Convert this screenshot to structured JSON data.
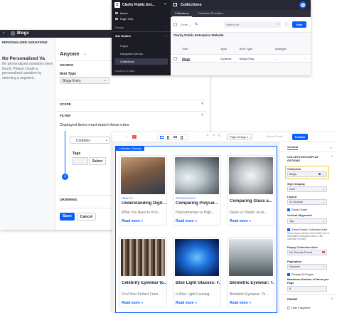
{
  "left_window": {
    "title": "Blogs",
    "panel_heading": "PERSONALIZED VARIATIONS",
    "no_var_title": "No Personalized Va",
    "no_var_desc": "No personalized variations were found. Please create a personalized variation by selecting a segment.",
    "segment": "Anyone",
    "source_label": "SOURCE",
    "item_type_label": "Item Type",
    "item_type_value": "Blogs Entry",
    "scope_label": "SCOPE",
    "filter_label": "FILTER",
    "filter_desc": "Displayed items must match these rules.",
    "contains_value": "Contains",
    "tags_label": "Tags",
    "select_label": "Select",
    "ordering_label": "ORDERING",
    "save_label": "Save",
    "cancel_label": "Cancel"
  },
  "top_window": {
    "app_title": "Clarity Public Ent...",
    "nav": [
      "Home",
      "Page Tree",
      "Design",
      "Site Builder",
      "Pages",
      "Navigation Menus",
      "Collections",
      "Content & Data"
    ],
    "header_title": "Collections",
    "tabs": [
      "Collections",
      "Collection Providers"
    ],
    "order_label": "Order",
    "search_placeholder": "Search for",
    "new_label": "New",
    "site_name": "Clarity Public Enterprise Website",
    "columns": [
      "Title",
      "Type",
      "Item Type",
      "Subtype"
    ],
    "row": {
      "title": "Blogs",
      "type": "Dynamic",
      "item_type": "Blogs Entry",
      "subtype": "-"
    },
    "avatar": "C"
  },
  "editor": {
    "page_design": "Page Design 1",
    "discard_label": "Discard Draft",
    "publish_label": "Publish",
    "collection_display_tag": "Collection Display",
    "cards": [
      {
        "category": "HEALTH",
        "title": "Understanding Digit...",
        "summary": "What You Need to Kno...",
        "more": "Read more »"
      },
      {
        "category": "TECHNOLOGY",
        "title": "Comparing Polycar...",
        "summary": "Polycarbonate vs High...",
        "more": "Read more »"
      },
      {
        "category": "",
        "title": "Comparing Glass a...",
        "summary": "Glass vs Plastic: A cle...",
        "more": "Read more »"
      },
      {
        "category": "",
        "title": "Celebrity Eyewear to...",
        "summary": "Find Your Perfect Fram...",
        "more": "Read more »"
      },
      {
        "category": "",
        "title": "Blue Light Glasses: F...",
        "summary": "Is Blue Light Causing...",
        "more": "Read more »"
      },
      {
        "category": "",
        "title": "Biometric Eyewear: T...",
        "summary": "Biometric Eyewear: Th...",
        "more": "Read more »"
      }
    ]
  },
  "config": {
    "tab": "General",
    "section": "COLLECTION DISPLAY OPTIONS",
    "collection_label": "Collection",
    "collection_value": "Blogs",
    "style_display_label": "Style Display",
    "style_display_value": "Grid",
    "layout_label": "Layout",
    "layout_value": "3 Columns",
    "show_gutter": "Show Gutter",
    "vertical_alignment_label": "Vertical Alignment",
    "vertical_alignment_value": "Top",
    "show_empty": "Show Empty Collection Alert",
    "empty_desc": "Show empty collection alert if there are no information message to show. If the collection is empty.",
    "empty_alert_label": "Empty Collection Alert",
    "empty_alert_value": "No Results Found",
    "pagination_label": "Pagination",
    "pagination_value": "Numeric",
    "display_all_pages": "Display All Pages",
    "max_items_label": "Maximum Number of Items per Page",
    "max_items_value": "6",
    "frame_label": "FRAME",
    "hide_fragment": "Hide Fragment"
  }
}
